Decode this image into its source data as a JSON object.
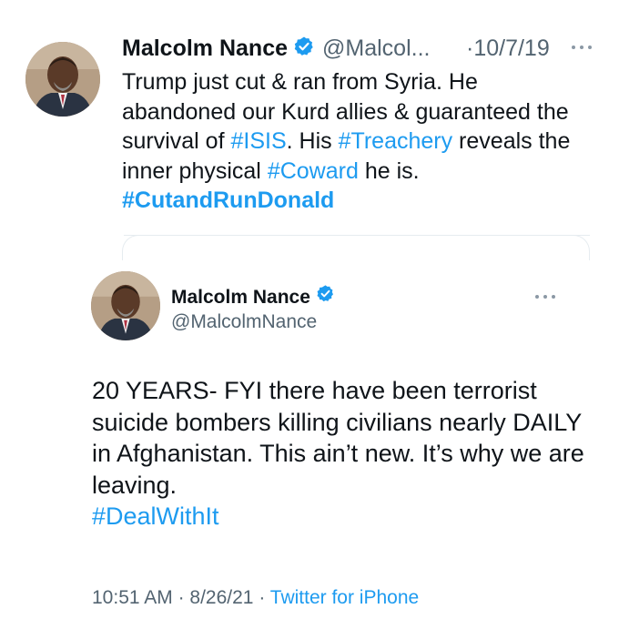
{
  "tweet1": {
    "name": "Malcolm Nance",
    "handle": "@Malcol...",
    "date": "·10/7/19",
    "text_plain_1": "Trump just cut & ran from Syria. He abandoned our Kurd allies & guaranteed the survival of ",
    "tag_isis": "#ISIS",
    "text_plain_2": ". His ",
    "tag_treachery": "#Treachery",
    "text_plain_3": " reveals the inner physical ",
    "tag_coward": "#Coward",
    "text_plain_4": " he is.",
    "tag_cutandrun": "#CutandRunDonald"
  },
  "tweet2": {
    "name": "Malcolm Nance",
    "handle": "@MalcolmNance",
    "text": "20 YEARS- FYI there have been terrorist suicide bombers killing civilians nearly DAILY in Afghanistan. This ain’t new. It’s why we are leaving.",
    "tag_dealwithit": "#DealWithIt",
    "time": "10:51 AM",
    "sep1": " · ",
    "date": "8/26/21",
    "sep2": " · ",
    "source": "Twitter for iPhone"
  },
  "icons": {
    "verified": "verified-badge-icon",
    "more": "more-dots-icon"
  },
  "colors": {
    "link": "#1d9bf0",
    "secondary": "#536471",
    "text": "#0f1419",
    "border": "#e6ecf0"
  }
}
